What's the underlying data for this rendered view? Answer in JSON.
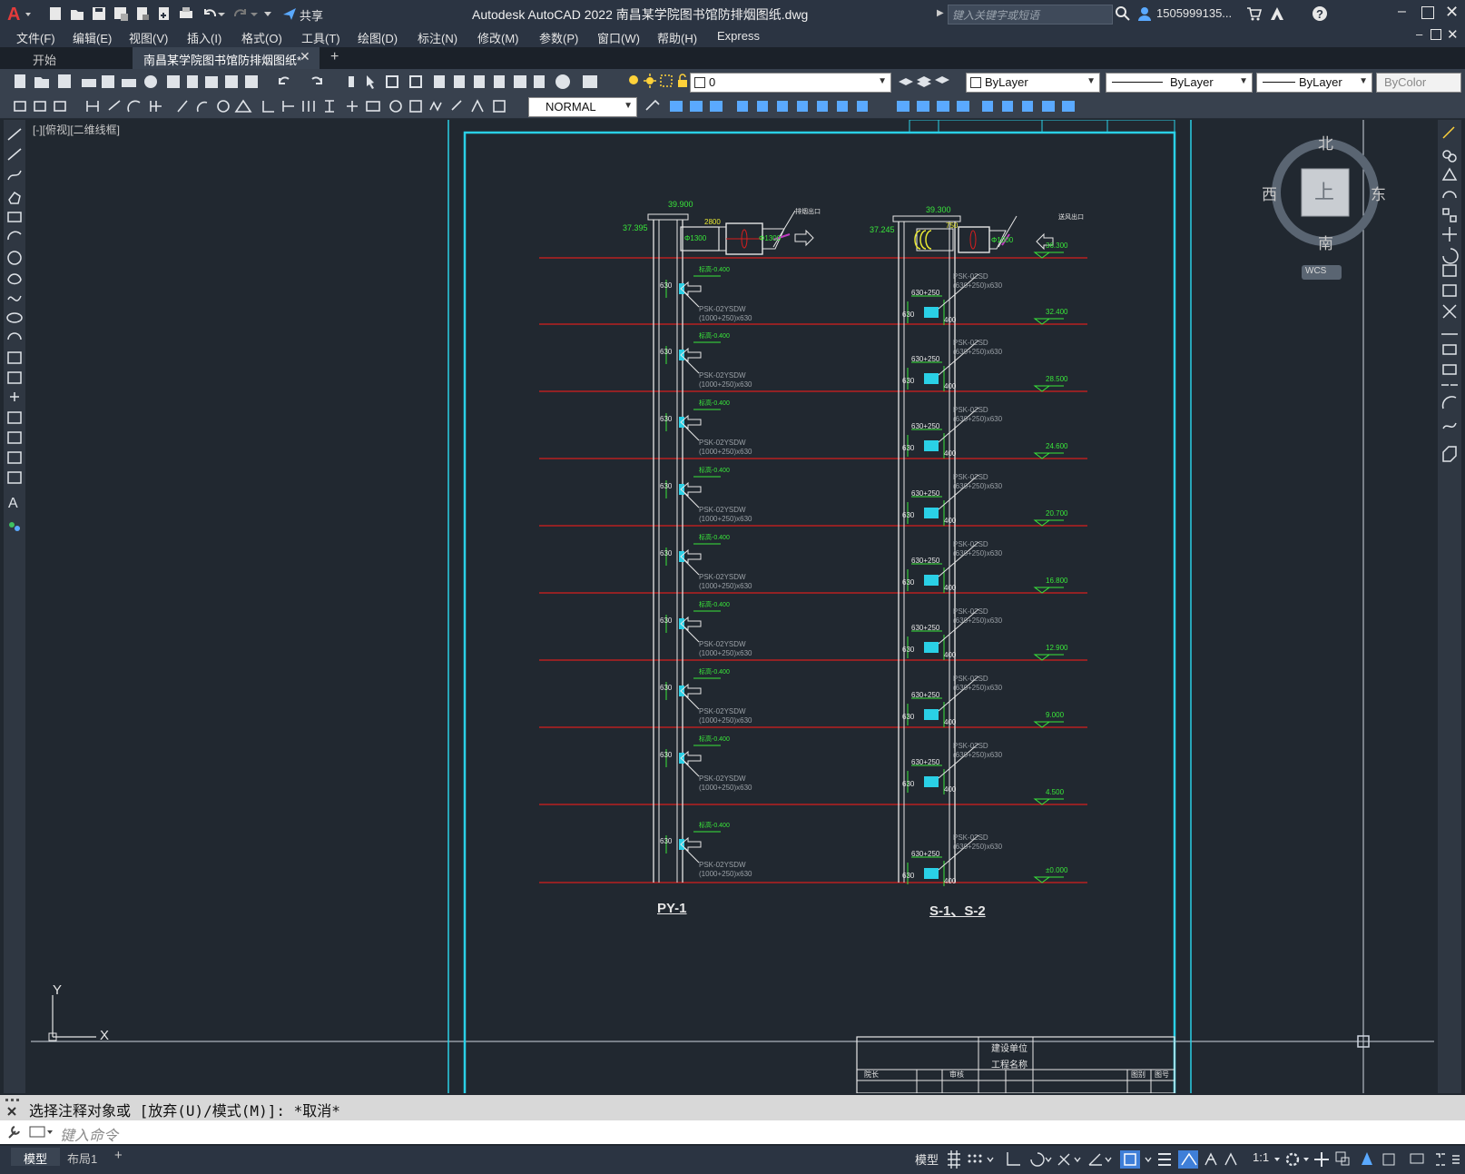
{
  "app": {
    "title": "Autodesk AutoCAD 2022    南昌某学院图书馆防排烟图纸.dwg",
    "share_label": "共享",
    "search_placeholder": "键入关键字或短语",
    "user": "1505999135...",
    "accent": "#e23b3b"
  },
  "menu": [
    "文件(F)",
    "编辑(E)",
    "视图(V)",
    "插入(I)",
    "格式(O)",
    "工具(T)",
    "绘图(D)",
    "标注(N)",
    "修改(M)",
    "参数(P)",
    "窗口(W)",
    "帮助(H)",
    "Express"
  ],
  "tabs": {
    "start": "开始",
    "active": "南昌某学院图书馆防排烟图纸*",
    "add": "+"
  },
  "properties": {
    "layer": "0",
    "color": "ByLayer",
    "linetype": "ByLayer",
    "lineweight": "ByLayer",
    "plotstyle": "ByColor",
    "text_style": "NORMAL"
  },
  "viewport": {
    "label": "[-][俯视][二维线框]",
    "viewcube": {
      "north": "北",
      "south": "南",
      "east": "东",
      "west": "西",
      "top": "上",
      "wcs": "WCS"
    },
    "ucs": {
      "x": "X",
      "y": "Y"
    }
  },
  "drawing": {
    "left_system": {
      "label": "PY-1",
      "top_elev_1": "39.900",
      "top_elev_2": "37.395",
      "fan_note_1": "Φ1300",
      "fan_note_2": "Φ1300",
      "size_note": "2800",
      "outlet_note": "排烟出口",
      "floor_tag": "标高-0.400",
      "damper": "PSK-02YSDW",
      "damper_size": "(1000+250)x630",
      "duct_side": "630"
    },
    "right_system": {
      "label": "S-1、S-2",
      "top_elev_1": "39.300",
      "top_elev_2": "37.245",
      "fan_note": "Φ1000",
      "size_note": "750",
      "outlet_note": "送风出口",
      "damper": "PSK-02SD",
      "damper_size": "(630+250)x630",
      "grille": "630+250",
      "duct_side": "630",
      "dim_400": "400"
    },
    "elevations": [
      "36.300",
      "32.400",
      "28.500",
      "24.600",
      "20.700",
      "16.800",
      "12.900",
      "9.000",
      "4.500",
      "±0.000"
    ],
    "title_block": {
      "unit": "建设单位",
      "project": "工程名称",
      "head": "院长",
      "review": "审核",
      "drawing": "图别",
      "number": "图号"
    }
  },
  "command": {
    "history": "选择注释对象或 [放弃(U)/模式(M)]: *取消*",
    "placeholder": "键入命令"
  },
  "status": {
    "model_tab": "模型",
    "layout_tab": "布局1",
    "add_tab": "+",
    "model_btn": "模型",
    "scale": "1:1"
  }
}
